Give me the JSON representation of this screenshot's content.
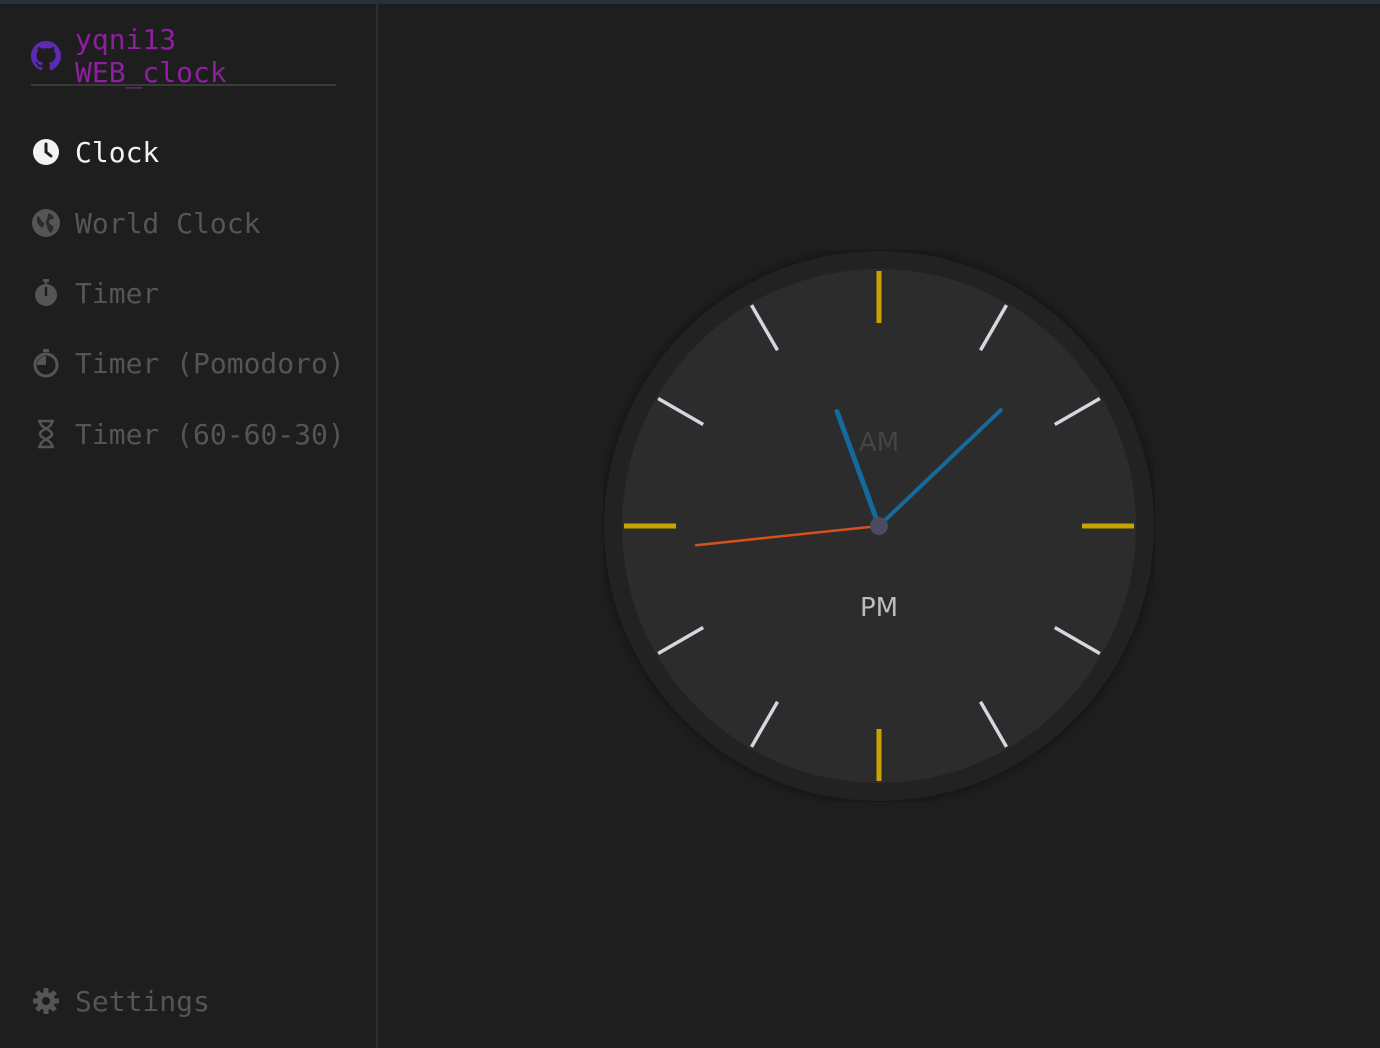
{
  "window": {
    "title": ""
  },
  "brand": {
    "label": "yqni13 WEB_clock",
    "icon": "github-icon",
    "color": "#8e1fa0"
  },
  "nav": {
    "items": [
      {
        "label": "Clock",
        "icon": "clock-icon",
        "active": true
      },
      {
        "label": "World Clock",
        "icon": "globe-icon",
        "active": false
      },
      {
        "label": "Timer",
        "icon": "stopwatch-icon",
        "active": false
      },
      {
        "label": "Timer (Pomodoro)",
        "icon": "timer-icon",
        "active": false
      },
      {
        "label": "Timer (60-60-30)",
        "icon": "hourglass-icon",
        "active": false
      }
    ],
    "settings": {
      "label": "Settings",
      "icon": "gear-icon"
    }
  },
  "clock": {
    "am_label": "AM",
    "pm_label": "PM",
    "period": "PM",
    "hour": 12,
    "minute": 7,
    "second": 44,
    "colors": {
      "face": "#2c2c2c",
      "rim": "#232323",
      "major_tick": "#c8a400",
      "minor_tick": "#d6d6e0",
      "hour_hand": "#146a9c",
      "minute_hand": "#146a9c",
      "second_hand": "#d5501c",
      "center": "#4a4a60",
      "period_active": "#bdbdbd",
      "period_inactive": "#444444"
    }
  }
}
